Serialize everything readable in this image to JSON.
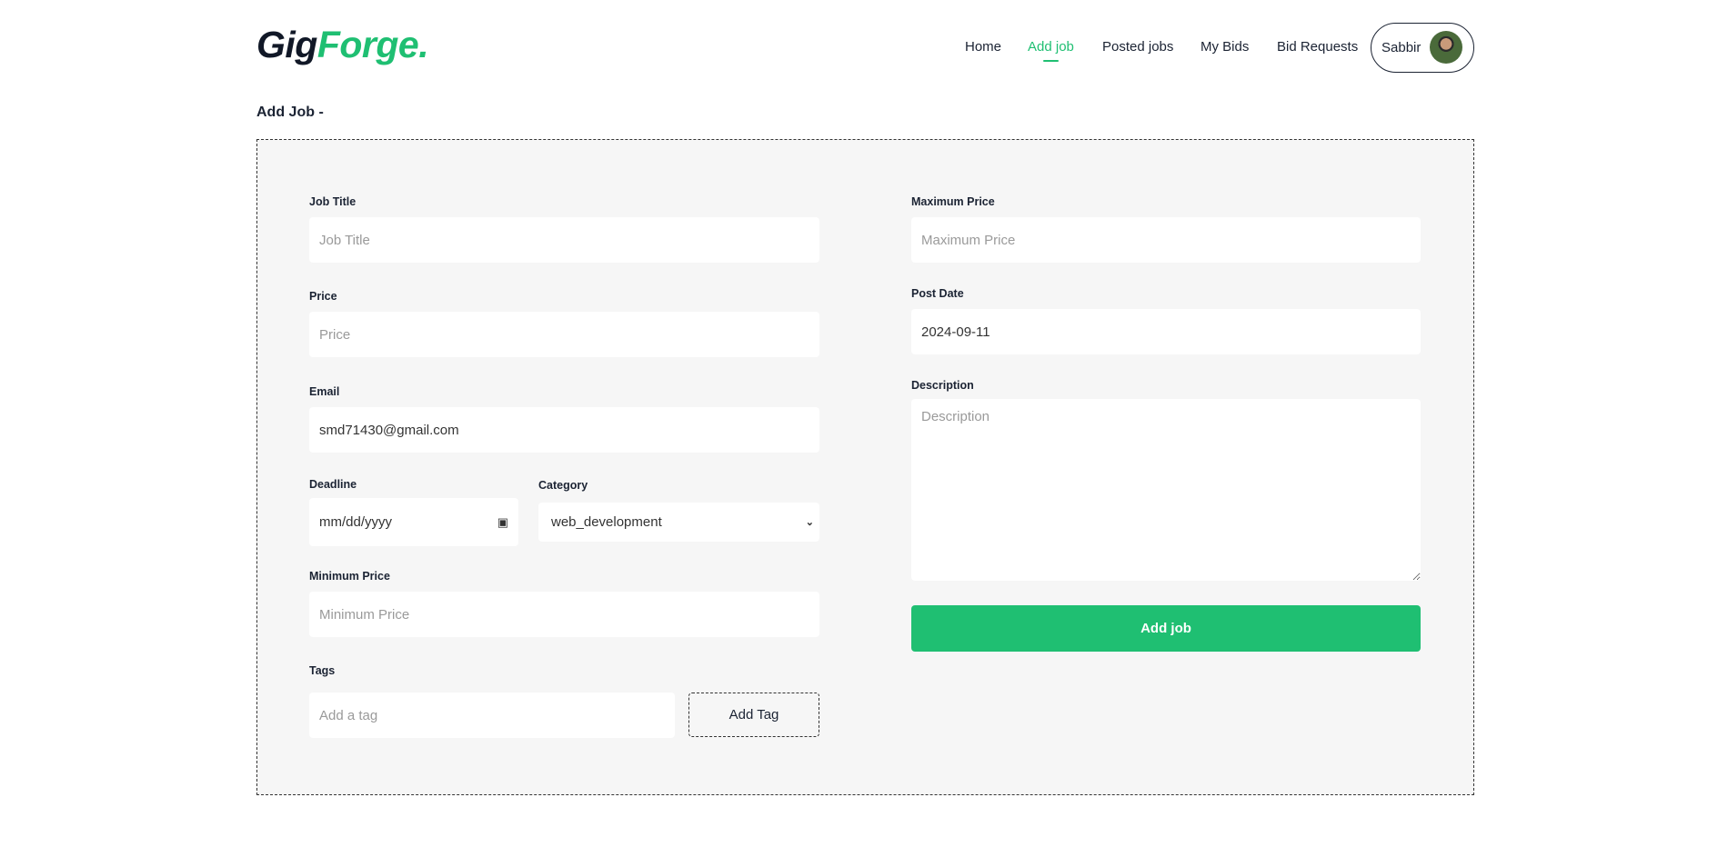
{
  "brand": {
    "part1": "Gig",
    "part2": "Forge.",
    "accent": "#1fbf72"
  },
  "nav": {
    "items": [
      {
        "label": "Home"
      },
      {
        "label": "Add job",
        "active": true
      },
      {
        "label": "Posted jobs"
      },
      {
        "label": "My Bids"
      },
      {
        "label": "Bid Requests"
      }
    ],
    "user": "Sabbir"
  },
  "page_title": "Add Job -",
  "form": {
    "job_title": {
      "label": "Job Title",
      "placeholder": "Job Title"
    },
    "price": {
      "label": "Price",
      "placeholder": "Price"
    },
    "email": {
      "label": "Email",
      "value": "smd71430@gmail.com"
    },
    "deadline": {
      "label": "Deadline",
      "placeholder": "mm/dd/yyyy"
    },
    "category": {
      "label": "Category",
      "value": "web_development"
    },
    "min_price": {
      "label": "Minimum Price",
      "placeholder": "Minimum Price"
    },
    "tags": {
      "label": "Tags",
      "placeholder": "Add a tag",
      "button": "Add Tag"
    },
    "max_price": {
      "label": "Maximum Price",
      "placeholder": "Maximum Price"
    },
    "post_date": {
      "label": "Post Date",
      "value": "2024-09-11"
    },
    "description": {
      "label": "Description",
      "placeholder": "Description"
    },
    "submit": "Add job"
  }
}
